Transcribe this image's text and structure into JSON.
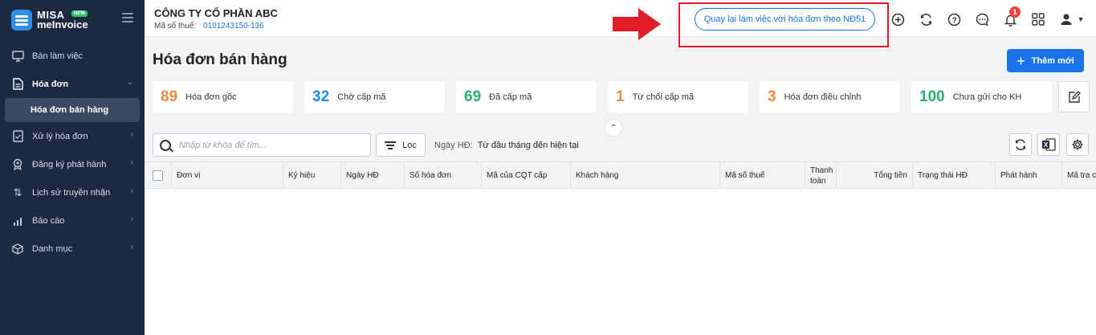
{
  "brand": {
    "name": "MISA",
    "product": "meInvoice",
    "badge": "NEW"
  },
  "sidebar": {
    "items": [
      {
        "label": "Bàn làm việc",
        "icon": "monitor-icon"
      },
      {
        "label": "Hóa đơn",
        "icon": "document-icon",
        "expanded": true
      },
      {
        "label": "Hóa đơn bán hàng",
        "sub": true,
        "active": true
      },
      {
        "label": "Xử lý hóa đơn",
        "icon": "invoice-check-icon"
      },
      {
        "label": "Đăng ký phát hành",
        "icon": "badge-icon"
      },
      {
        "label": "Lịch sử truyền nhận",
        "icon": "transfer-icon"
      },
      {
        "label": "Báo cáo",
        "icon": "bar-chart-icon"
      },
      {
        "label": "Danh mục",
        "icon": "box-icon"
      }
    ]
  },
  "header": {
    "company": "CÔNG TY CỔ PHẦN ABC",
    "tax_label": "Mã số thuế:",
    "tax_value": "0101243150-136",
    "nd51_button": "Quay lại làm việc với hóa đơn theo NĐ51",
    "notification_count": "1",
    "icons": [
      "add-circle-icon",
      "sync-icon",
      "help-icon",
      "chat-icon",
      "bell-icon",
      "grid-icon",
      "user-icon",
      "caret-down-icon"
    ]
  },
  "page": {
    "title": "Hóa đơn bán hàng",
    "add_button": "Thêm mới"
  },
  "stats": [
    {
      "value": "89",
      "label": "Hóa đơn gốc",
      "color": "#f0883e"
    },
    {
      "value": "32",
      "label": "Chờ cấp mã",
      "color": "#1a8fe3"
    },
    {
      "value": "69",
      "label": "Đã cấp mã",
      "color": "#27b36a"
    },
    {
      "value": "1",
      "label": "Từ chối cấp mã",
      "color": "#f0883e"
    },
    {
      "value": "3",
      "label": "Hóa đơn điều chỉnh",
      "color": "#f0883e"
    },
    {
      "value": "100",
      "label": "Chưa gửi cho KH",
      "color": "#27b36a"
    }
  ],
  "toolbar": {
    "search_placeholder": "Nhập từ khóa để tìm...",
    "filter_label": "Lọc",
    "date_label": "Ngày HĐ:",
    "date_value": "Từ đầu tháng đến hiện tại"
  },
  "table": {
    "columns": [
      "Đơn vị",
      "Ký hiệu",
      "Ngày HĐ",
      "Số hóa đơn",
      "Mã của CQT cấp",
      "Khách hàng",
      "Mã số thuế",
      "Thanh toán",
      "Tổng tiền",
      "Trạng thái HĐ",
      "Phát hành",
      "Mã tra c"
    ]
  }
}
